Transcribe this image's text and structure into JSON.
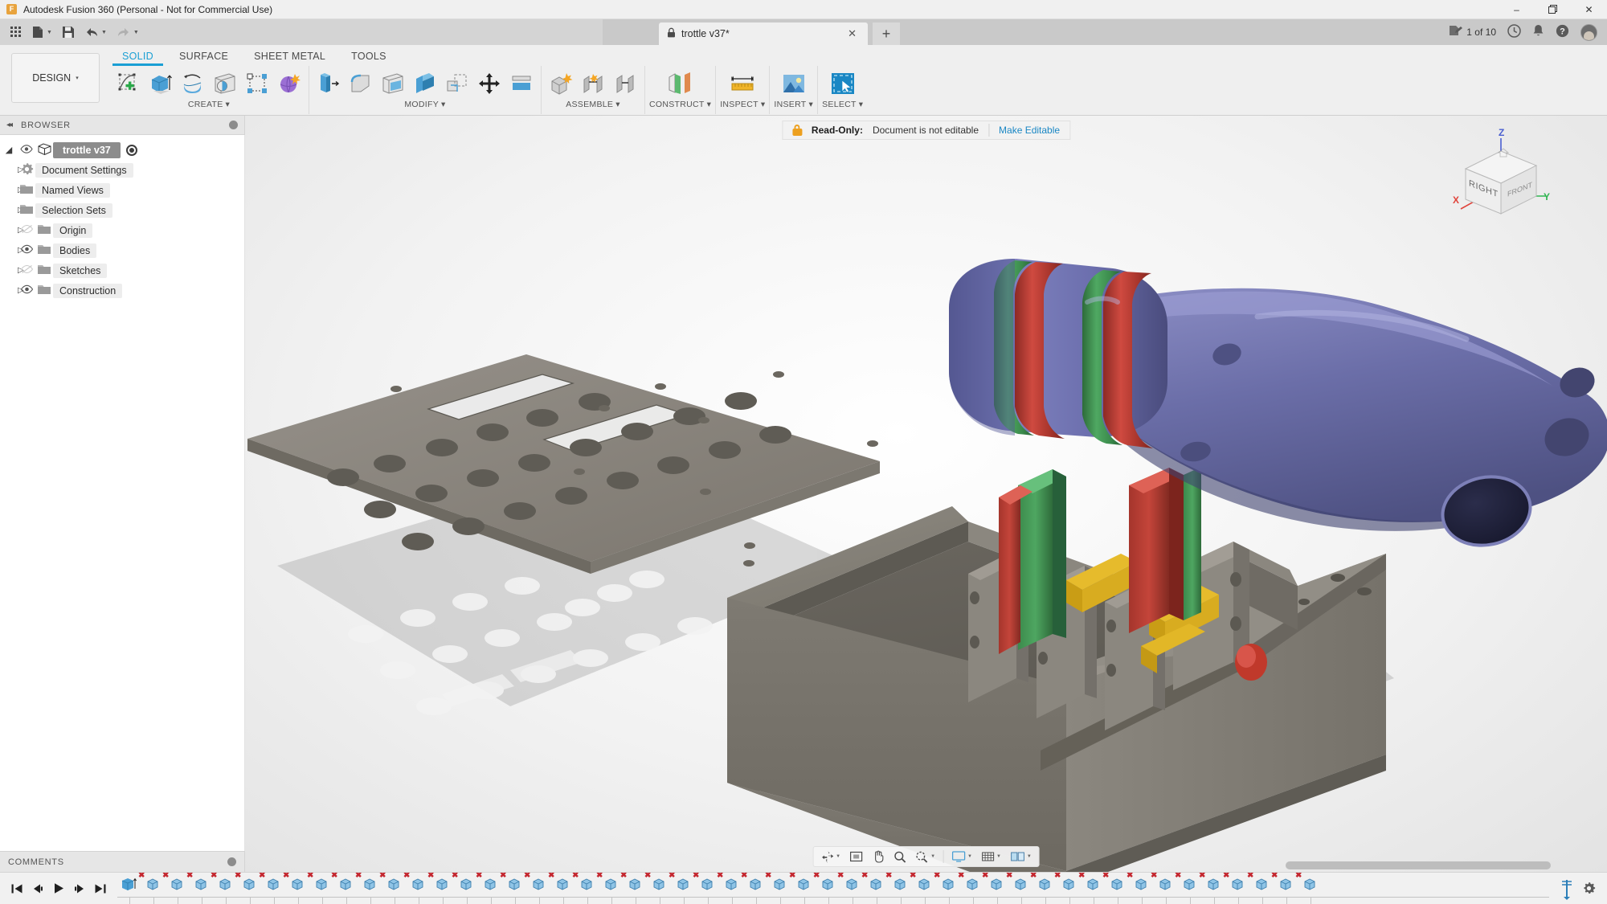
{
  "window": {
    "title": "Autodesk Fusion 360 (Personal - Not for Commercial Use)",
    "logo_letter": "F",
    "minimize": "–",
    "maximize": "❐",
    "close": "✕"
  },
  "quick_access": {
    "items": [
      {
        "name": "app-grid-icon",
        "glyph": "☷",
        "has_caret": false
      },
      {
        "name": "new-file-icon",
        "glyph": "὜E",
        "has_caret": true
      },
      {
        "name": "save-icon",
        "glyph": "὚B",
        "has_caret": false
      },
      {
        "name": "undo-icon",
        "glyph": "↶",
        "has_caret": true
      },
      {
        "name": "redo-icon",
        "glyph": "↷",
        "has_caret": true
      }
    ]
  },
  "document_tab": {
    "label": "trottle v37*",
    "lock_icon": "lock-icon",
    "close_glyph": "✕",
    "new_tab_glyph": "+",
    "doc_count": "1 of 10",
    "right_icons": [
      {
        "name": "job-status-icon",
        "glyph": "὜D"
      },
      {
        "name": "recent-activity-icon",
        "glyph": "ὕ4"
      },
      {
        "name": "notifications-bell-icon",
        "glyph": "ὑ4"
      },
      {
        "name": "help-icon",
        "glyph": "?"
      }
    ],
    "avatar_name": "user-avatar"
  },
  "ribbon": {
    "workspace_selector": "DESIGN",
    "workspace_caret": "▾",
    "tabs": [
      {
        "label": "SOLID",
        "active": true
      },
      {
        "label": "SURFACE",
        "active": false
      },
      {
        "label": "SHEET METAL",
        "active": false
      },
      {
        "label": "TOOLS",
        "active": false
      }
    ],
    "groups": [
      {
        "label": "CREATE",
        "caret": "▾",
        "icons": [
          {
            "name": "create-sketch-icon"
          },
          {
            "name": "extrude-icon"
          },
          {
            "name": "revolve-icon"
          },
          {
            "name": "hole-icon"
          },
          {
            "name": "rib-pattern-icon"
          },
          {
            "name": "create-form-icon"
          }
        ]
      },
      {
        "label": "MODIFY",
        "caret": "▾",
        "icons": [
          {
            "name": "press-pull-icon"
          },
          {
            "name": "fillet-icon"
          },
          {
            "name": "shell-icon"
          },
          {
            "name": "draft-icon"
          },
          {
            "name": "scale-icon"
          },
          {
            "name": "move-copy-icon"
          },
          {
            "name": "align-icon"
          }
        ]
      },
      {
        "label": "ASSEMBLE",
        "caret": "▾",
        "icons": [
          {
            "name": "new-component-icon"
          },
          {
            "name": "joint-icon"
          },
          {
            "name": "rigid-group-icon"
          }
        ]
      },
      {
        "label": "CONSTRUCT",
        "caret": "▾",
        "icons": [
          {
            "name": "construction-plane-icon"
          }
        ]
      },
      {
        "label": "INSPECT",
        "caret": "▾",
        "icons": [
          {
            "name": "measure-ruler-icon"
          }
        ]
      },
      {
        "label": "INSERT",
        "caret": "▾",
        "icons": [
          {
            "name": "insert-image-icon"
          }
        ]
      },
      {
        "label": "SELECT",
        "caret": "▾",
        "icons": [
          {
            "name": "select-window-icon"
          }
        ]
      }
    ]
  },
  "browser": {
    "title": "BROWSER",
    "collapse_glyph": "◂◂",
    "root": {
      "label": "trottle v37",
      "arrow": "◢",
      "eye": "◉",
      "body_icon": "component-cube-icon"
    },
    "items": [
      {
        "label": "Document Settings",
        "arrow": "▷",
        "icon": "gear-icon",
        "eye": null,
        "eye_off": false
      },
      {
        "label": "Named Views",
        "arrow": "▷",
        "icon": "folder-icon",
        "eye": null,
        "eye_off": false
      },
      {
        "label": "Selection Sets",
        "arrow": "▷",
        "icon": "folder-icon",
        "eye": null,
        "eye_off": false
      },
      {
        "label": "Origin",
        "arrow": "▷",
        "icon": "folder-icon",
        "eye": "eye-off-icon",
        "eye_off": true
      },
      {
        "label": "Bodies",
        "arrow": "▷",
        "icon": "folder-icon",
        "eye": "eye-icon",
        "eye_off": false
      },
      {
        "label": "Sketches",
        "arrow": "▷",
        "icon": "folder-icon",
        "eye": "eye-off-icon",
        "eye_off": true
      },
      {
        "label": "Construction",
        "arrow": "▷",
        "icon": "folder-icon",
        "eye": "eye-icon",
        "eye_off": false
      }
    ]
  },
  "comments": {
    "title": "COMMENTS",
    "add_glyph": "⊕"
  },
  "canvas": {
    "readonly": {
      "strong": "Read-Only:",
      "text": "Document is not editable",
      "link": "Make Editable"
    },
    "viewcube": {
      "face": "RIGHT",
      "face_right": "FRONT",
      "axis_z": "Z",
      "axis_y": "Y",
      "axis_x": "X",
      "home_icon": "home-icon"
    },
    "view_toolbar": [
      {
        "name": "orbit-icon",
        "glyph": "✥",
        "caret": false
      },
      {
        "name": "fit-icon",
        "glyph": "▣",
        "caret": false
      },
      {
        "name": "pan-icon",
        "glyph": "✋",
        "caret": false
      },
      {
        "name": "zoom-icon",
        "glyph": "ὐD",
        "caret": false
      },
      {
        "name": "zoom-window-icon",
        "glyph": "ὐE",
        "caret": true
      },
      {
        "name": "display-settings-icon",
        "glyph": "὚5",
        "caret": true
      },
      {
        "name": "grid-snaps-icon",
        "glyph": "☷",
        "caret": true
      },
      {
        "name": "viewports-icon",
        "glyph": "▭",
        "caret": true
      }
    ],
    "model_description": "Exploded CAD assembly: gray perforated cover plate, gray enclosure box, blue-purple intake manifold, red/green/yellow internal fixtures"
  },
  "timeline": {
    "playback": [
      {
        "name": "go-to-beginning-button",
        "glyph": "⏮"
      },
      {
        "name": "step-back-button",
        "glyph": "⏴"
      },
      {
        "name": "play-button",
        "glyph": "▶"
      },
      {
        "name": "step-forward-button",
        "glyph": "⏵"
      },
      {
        "name": "go-to-end-button",
        "glyph": "⏭"
      }
    ],
    "feature_count": 49,
    "first_feature": {
      "name": "extrude-feature-icon",
      "error": false
    },
    "feature_icon": "component-feature-icon",
    "error_badge": "✖",
    "end_marker": "timeline-end-marker",
    "settings_icon": "gear-icon",
    "settings_glyph": "⚙"
  },
  "colors": {
    "accent": "#1a9fd4",
    "link": "#1a87c4",
    "lock_orange": "#eda01f",
    "error_red": "#c4262e",
    "model_blue": "#6b6ea8",
    "model_gray": "#8a857b",
    "model_red": "#b73a32",
    "model_green": "#3f8f4f",
    "model_yellow": "#e0b020",
    "axis_z": "#4a5fd0",
    "axis_y": "#2fb551",
    "axis_x": "#e0443b"
  }
}
